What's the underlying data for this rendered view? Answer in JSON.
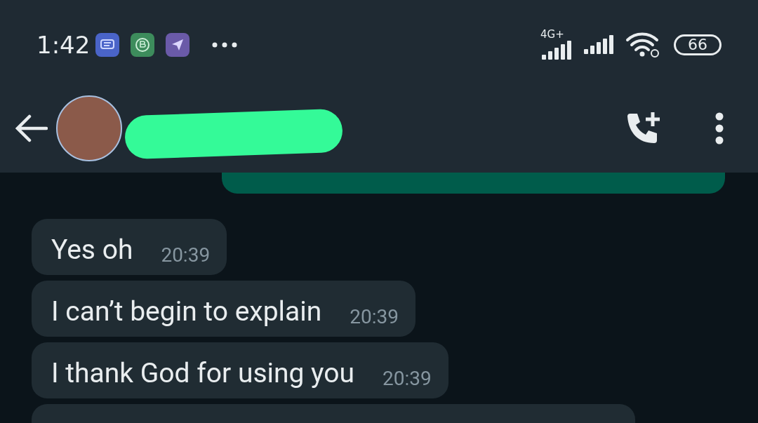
{
  "status_bar": {
    "time": "1:42",
    "network": "4G+",
    "battery": "66"
  },
  "messages": [
    {
      "kind": "received",
      "text": "Yes oh",
      "time": "20:39"
    },
    {
      "kind": "received",
      "text": "I can’t begin to explain",
      "time": "20:39"
    },
    {
      "kind": "received",
      "text": "I thank God for using you",
      "time": "20:39"
    }
  ]
}
